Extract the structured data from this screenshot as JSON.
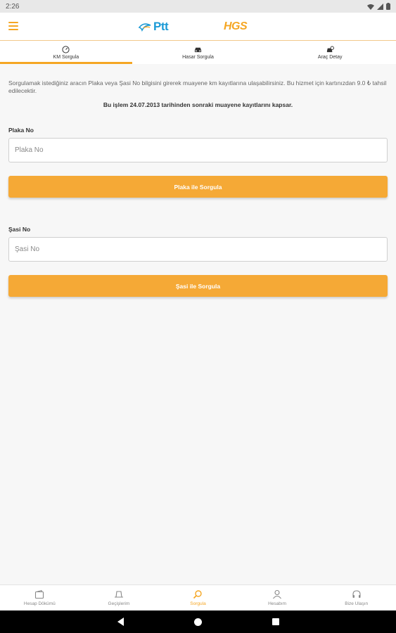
{
  "status_bar": {
    "time": "2:26"
  },
  "header": {
    "ptt_logo": "Ptt",
    "hgs_logo": "HGS",
    "brand_color": "#f5a623",
    "ptt_color": "#1b9ad6"
  },
  "tabs": [
    {
      "label": "KM Sorgula",
      "icon": "speedometer-icon",
      "active": true
    },
    {
      "label": "Hasar Sorgula",
      "icon": "car-crash-icon",
      "active": false
    },
    {
      "label": "Araç Detay",
      "icon": "car-detail-icon",
      "active": false
    }
  ],
  "main": {
    "info_text": "Sorgulamak istediğiniz aracın Plaka veya Şasi No bilgisini girerek muayene km kayıtlarına ulaşabilirsiniz. Bu hizmet için kartınızdan 9.0 ₺ tahsil edilecektir.",
    "notice_text": "Bu işlem 24.07.2013 tarihinden sonraki muayene kayıtlarını kapsar.",
    "plaka": {
      "label": "Plaka No",
      "placeholder": "Plaka No",
      "value": "",
      "button": "Plaka ile Sorgula"
    },
    "sasi": {
      "label": "Şasi No",
      "placeholder": "Şasi No",
      "value": "",
      "button": "Şasi ile Sorgula"
    }
  },
  "bottom_nav": [
    {
      "label": "Hesap Dökümü",
      "icon": "wallet-icon",
      "active": false
    },
    {
      "label": "Geçişlerim",
      "icon": "toll-gate-icon",
      "active": false
    },
    {
      "label": "Sorgula",
      "icon": "search-icon",
      "active": true
    },
    {
      "label": "Hesabım",
      "icon": "user-icon",
      "active": false
    },
    {
      "label": "Bize Ulaşın",
      "icon": "headset-icon",
      "active": false
    }
  ]
}
